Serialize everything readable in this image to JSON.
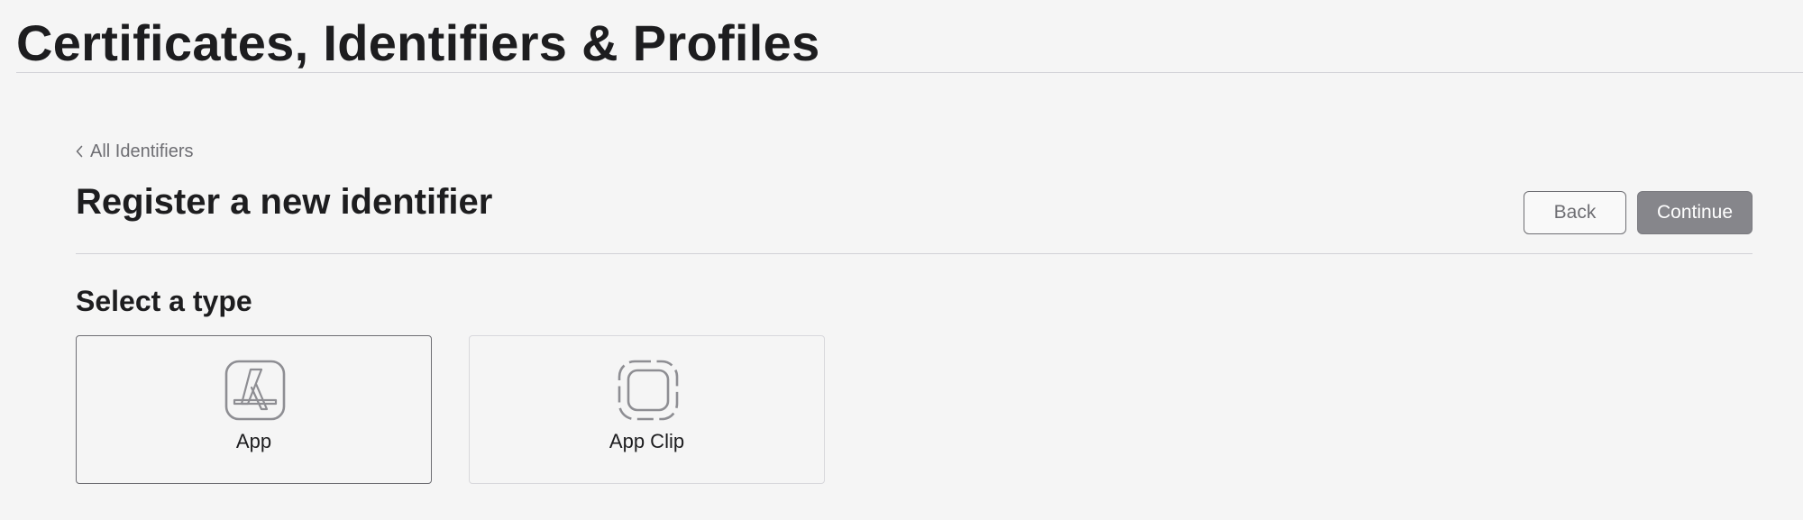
{
  "header": {
    "title": "Certificates, Identifiers & Profiles"
  },
  "breadcrumb": {
    "label": "All Identifiers",
    "icon": "chevron-left-icon"
  },
  "page": {
    "heading": "Register a new identifier",
    "back_label": "Back",
    "continue_label": "Continue"
  },
  "type_selector": {
    "heading": "Select a type",
    "options": [
      {
        "label": "App",
        "icon": "app-store-icon",
        "selected": true
      },
      {
        "label": "App Clip",
        "icon": "app-clip-icon",
        "selected": false
      }
    ]
  },
  "colors": {
    "background": "#f5f5f5",
    "text": "#1d1d1f",
    "muted_text": "#6e6e73",
    "continue_button": "#86868b",
    "divider": "#d2d2d7"
  }
}
